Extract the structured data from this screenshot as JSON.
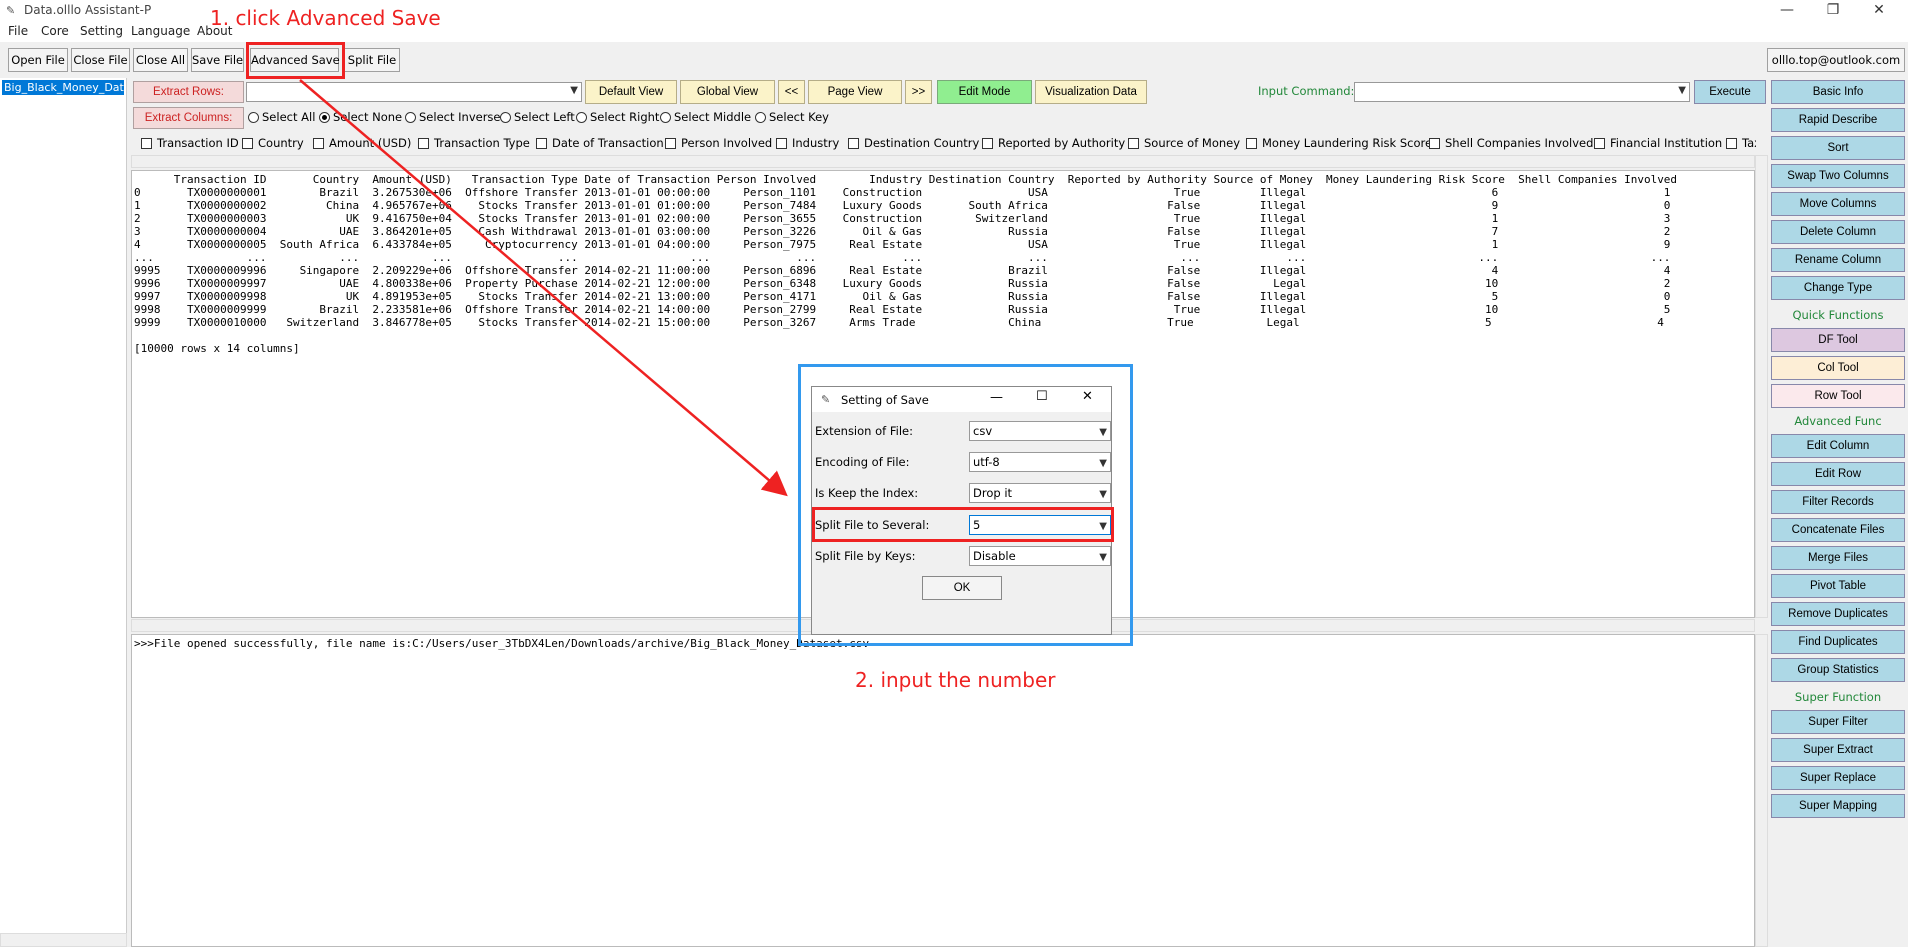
{
  "window": {
    "title": "Data.olllo Assistant-P",
    "icon": "feather-icon",
    "controls": [
      "minimize-icon",
      "restore-icon",
      "close-icon"
    ]
  },
  "menu": [
    "File",
    "Core",
    "Setting",
    "Language",
    "About"
  ],
  "toolbar": {
    "buttons": [
      "Open File",
      "Close File",
      "Close All",
      "Save File",
      "Advanced Save",
      "Split File"
    ],
    "email": "olllo.top@outlook.com"
  },
  "left_panel": {
    "selected_file": "Big_Black_Money_Data"
  },
  "controls": {
    "extract_rows": "Extract Rows:",
    "extract_columns": "Extract Columns:",
    "view_buttons": [
      "Default View",
      "Global View",
      "<<",
      "Page View",
      ">>",
      "Edit Mode",
      "Visualization Data"
    ],
    "input_command_label": "Input Command:",
    "execute": "Execute",
    "radios": [
      "Select All",
      "Select None",
      "Select Inverse",
      "Select Left",
      "Select Right",
      "Select Middle",
      "Select Key"
    ],
    "selected_radio": "Select None",
    "columns": [
      "Transaction ID",
      "Country",
      "Amount (USD)",
      "Transaction Type",
      "Date of Transaction",
      "Person Involved",
      "Industry",
      "Destination Country",
      "Reported by Authority",
      "Source of Money",
      "Money Laundering Risk Score",
      "Shell Companies Involved",
      "Financial Institution",
      "Tax H"
    ]
  },
  "data_view": {
    "lines": [
      "      Transaction ID       Country  Amount (USD)   Transaction Type Date of Transaction Person Involved        Industry Destination Country  Reported by Authority Source of Money  Money Laundering Risk Score  Shell Companies Involved",
      "0       TX0000000001        Brazil  3.267530e+06  Offshore Transfer 2013-01-01 00:00:00     Person_1101    Construction                USA                   True         Illegal                            6                         1",
      "1       TX0000000002         China  4.965767e+06    Stocks Transfer 2013-01-01 01:00:00     Person_7484    Luxury Goods       South Africa                  False         Illegal                            9                         0",
      "2       TX0000000003            UK  9.416750e+04    Stocks Transfer 2013-01-01 02:00:00     Person_3655    Construction        Switzerland                   True         Illegal                            1                         3",
      "3       TX0000000004           UAE  3.864201e+05    Cash Withdrawal 2013-01-01 03:00:00     Person_3226       Oil & Gas             Russia                  False         Illegal                            7                         2",
      "4       TX0000000005  South Africa  6.433784e+05     Cryptocurrency 2013-01-01 04:00:00     Person_7975     Real Estate                USA                   True         Illegal                            1                         9",
      "...              ...           ...           ...                ...                 ...             ...             ...                ...                    ...             ...                          ...                       ...",
      "9995    TX0000009996     Singapore  2.209229e+06  Offshore Transfer 2014-02-21 11:00:00     Person_6896     Real Estate             Brazil                  False         Illegal                            4                         4",
      "9996    TX0000009997           UAE  4.800338e+06  Property Purchase 2014-02-21 12:00:00     Person_6348    Luxury Goods             Russia                  False           Legal                           10                         2",
      "9997    TX0000009998            UK  4.891953e+05    Stocks Transfer 2014-02-21 13:00:00     Person_4171       Oil & Gas             Russia                  False         Illegal                            5                         0",
      "9998    TX0000009999        Brazil  2.233581e+06  Offshore Transfer 2014-02-21 14:00:00     Person_2799     Real Estate             Russia                   True         Illegal                           10                         5",
      "9999    TX0000010000   Switzerland  3.846778e+05    Stocks Transfer 2014-02-21 15:00:00     Person_3267     Arms Trade              China                   True           Legal                            5                         4",
      "",
      "[10000 rows x 14 columns]"
    ]
  },
  "log": ">>>File opened successfully, file name is:C:/Users/user_3TbDX4Len/Downloads/archive/Big_Black_Money_Dataset.csv",
  "right_panel": {
    "group1": [
      "Basic Info",
      "Rapid Describe",
      "Sort",
      "Swap Two Columns",
      "Move Columns",
      "Delete Column",
      "Rename Column",
      "Change Type"
    ],
    "section_quick": "Quick Functions",
    "quick": [
      "DF Tool",
      "Col Tool",
      "Row Tool"
    ],
    "section_advanced": "Advanced Func",
    "advanced": [
      "Edit Column",
      "Edit Row",
      "Filter Records",
      "Concatenate Files",
      "Merge Files",
      "Pivot Table",
      "Remove Duplicates",
      "Find Duplicates",
      "Group Statistics"
    ],
    "section_super": "Super Function",
    "super": [
      "Super Filter",
      "Super Extract",
      "Super Replace",
      "Super Mapping"
    ]
  },
  "dialog": {
    "title": "Setting of Save",
    "fields": [
      {
        "label": "Extension of File:",
        "value": "csv"
      },
      {
        "label": "Encoding of File:",
        "value": "utf-8"
      },
      {
        "label": "Is Keep the Index:",
        "value": "Drop it"
      },
      {
        "label": "Split File to Several:",
        "value": "5"
      },
      {
        "label": "Split File by Keys:",
        "value": "Disable"
      }
    ],
    "ok": "OK"
  },
  "annotations": {
    "step1": "1. click Advanced Save",
    "step2": "2. input the number",
    "color": "#ee2222",
    "highlight": "#3399ee"
  }
}
